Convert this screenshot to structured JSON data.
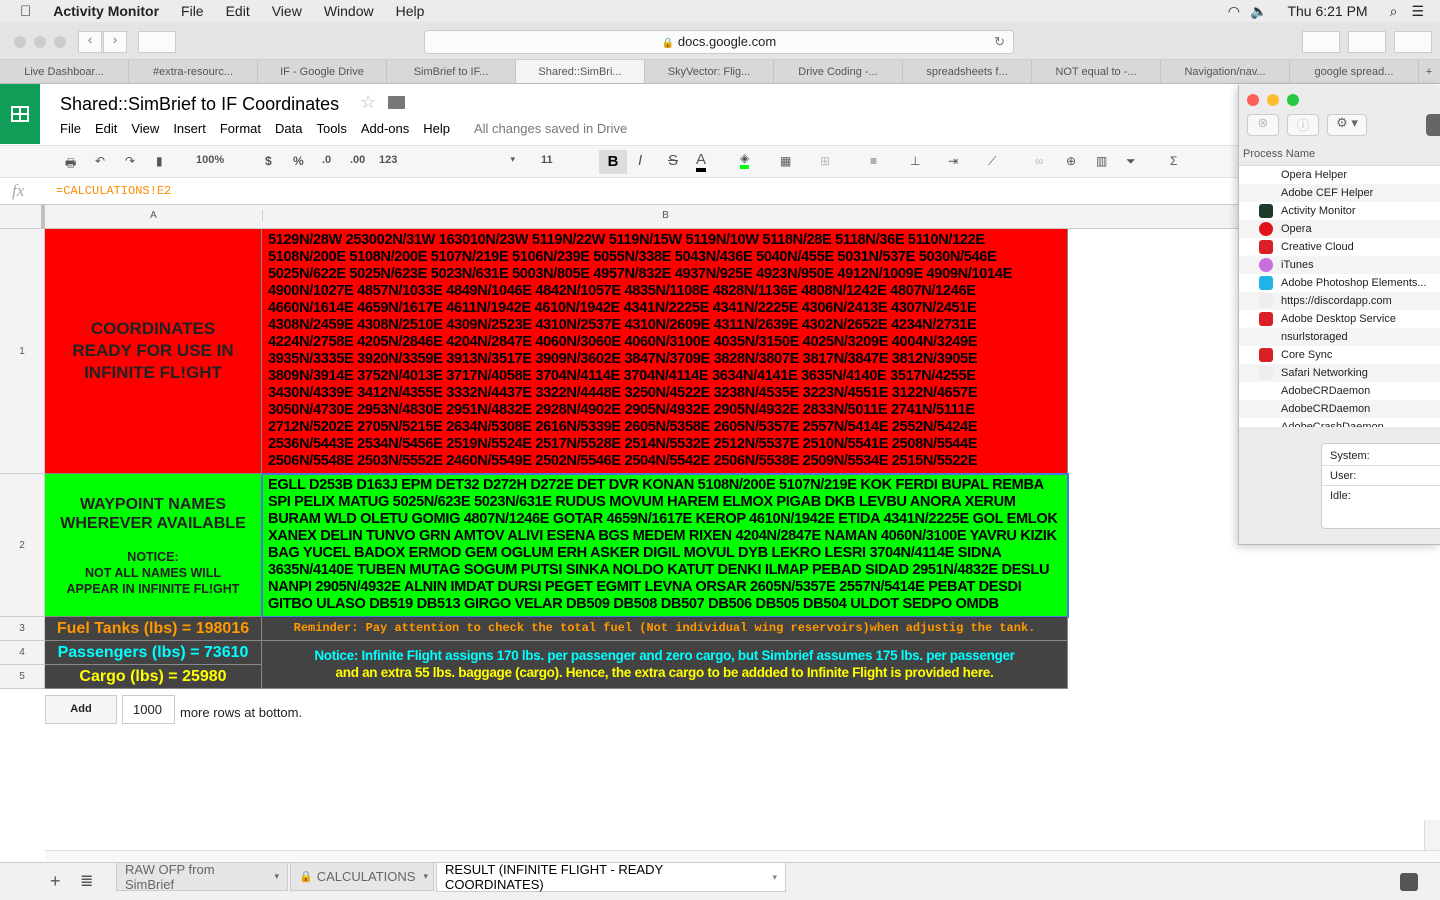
{
  "menubar": {
    "app": "Activity Monitor",
    "items": [
      "File",
      "Edit",
      "View",
      "Window",
      "Help"
    ],
    "clock": "Thu 6:21 PM"
  },
  "browser": {
    "url": "docs.google.com",
    "tabs": [
      "Live Dashboar...",
      "#extra-resourc...",
      "IF - Google Drive",
      "SimBrief to IF...",
      "Shared::SimBri...",
      "SkyVector: Flig...",
      "Drive Coding -...",
      "spreadsheets f...",
      "NOT equal to -...",
      "Navigation/nav...",
      "google spread..."
    ],
    "active_tab": 4
  },
  "doc": {
    "title": "Shared::SimBrief to IF Coordinates",
    "menus": [
      "File",
      "Edit",
      "View",
      "Insert",
      "Format",
      "Data",
      "Tools",
      "Add-ons",
      "Help"
    ],
    "save_status": "All changes saved in Drive"
  },
  "toolbar": {
    "zoom": "100%",
    "currency": "$",
    "percent": "%",
    "dec_less": ".0",
    "dec_more": ".00",
    "format": "123",
    "font_size": "11",
    "bold": "B",
    "italic": "I",
    "strike": "S",
    "text_color": "A"
  },
  "formula": {
    "fx": "fx",
    "value": "=CALCULATIONS!E2"
  },
  "columns": [
    "A",
    "B"
  ],
  "rows": [
    "1",
    "2",
    "3",
    "4",
    "5"
  ],
  "colors": {
    "red": "#ff0000",
    "green": "#00ff00",
    "dark": "#434343",
    "orange": "#ff9900",
    "cyan": "#00ffff",
    "yellow": "#ffff00"
  },
  "cells": {
    "a1": [
      "COORDINATES",
      "READY FOR USE IN",
      "INFINITE FL!GHT"
    ],
    "b1": [
      "5129N/28W 253002N/31W 163010N/23W 5119N/22W 5119N/15W 5119N/10W 5118N/28E 5118N/36E 5110N/122E",
      "5108N/200E 5108N/200E 5107N/219E 5106N/239E 5055N/338E 5043N/436E 5040N/455E 5031N/537E 5030N/546E",
      "5025N/622E 5025N/623E 5023N/631E 5003N/805E 4957N/832E 4937N/925E 4923N/950E 4912N/1009E 4909N/1014E",
      "4900N/1027E 4857N/1033E 4849N/1046E 4842N/1057E 4835N/1108E 4828N/1136E 4808N/1242E 4807N/1246E",
      "4660N/1614E 4659N/1617E 4611N/1942E 4610N/1942E 4341N/2225E 4341N/2225E 4306N/2413E 4307N/2451E",
      "4308N/2459E 4308N/2510E 4309N/2523E 4310N/2537E 4310N/2609E 4311N/2639E 4302N/2652E 4234N/2731E",
      "4224N/2758E 4205N/2846E 4204N/2847E 4060N/3060E 4060N/3100E 4035N/3150E 4025N/3209E 4004N/3249E",
      "3935N/3335E 3920N/3359E 3913N/3517E 3909N/3602E 3847N/3709E 3828N/3807E 3817N/3847E 3812N/3905E",
      "3809N/3914E 3752N/4013E 3717N/4058E 3704N/4114E 3704N/4114E 3634N/4141E 3635N/4140E 3517N/4255E",
      "3430N/4339E 3412N/4355E 3332N/4437E 3322N/4448E 3250N/4522E 3238N/4535E 3223N/4551E 3122N/4657E",
      "3050N/4730E 2953N/4830E 2951N/4832E 2928N/4902E 2905N/4932E 2905N/4932E 2833N/5011E 2741N/5111E",
      "2712N/5202E 2705N/5215E 2634N/5308E 2616N/5339E 2605N/5358E 2605N/5357E 2557N/5414E 2552N/5424E",
      "2536N/5443E 2534N/5456E 2519N/5524E 2517N/5528E 2514N/5532E 2512N/5537E 2510N/5541E 2508N/5544E",
      "2506N/5548E 2503N/5552E 2460N/5549E 2502N/5546E 2504N/5542E 2506N/5538E 2509N/5534E 2515N/5522E"
    ],
    "a2_title": [
      "WAYPOINT NAMES",
      "WHEREVER AVAILABLE"
    ],
    "a2_notice": [
      "NOTICE:",
      "NOT ALL NAMES WILL",
      "APPEAR IN INFINITE FL!GHT"
    ],
    "b2": [
      "EGLL D253B D163J EPM DET32 D272H D272E DET DVR KONAN 5108N/200E 5107N/219E KOK FERDI BUPAL REMBA",
      "SPI PELIX MATUG 5025N/623E 5023N/631E RUDUS MOVUM HAREM ELMOX PIGAB DKB LEVBU ANORA XERUM",
      "BURAM WLD OLETU GOMIG 4807N/1246E GOTAR 4659N/1617E KEROP 4610N/1942E ETIDA 4341N/2225E GOL EMLOK",
      "XANEX DELIN TUNVO GRN AMTOV ALIVI ESENA BGS MEDEM RIXEN 4204N/2847E NAMAN 4060N/3100E YAVRU KIZIK",
      "BAG YUCEL BADOX ERMOD GEM OGLUM ERH ASKER DIGIL MOVUL DYB LEKRO LESRI 3704N/4114E SIDNA",
      "3635N/4140E TUBEN MUTAG SOGUM PUTSI SINKA NOLDO KATUT DENKI ILMAP PEBAD SIDAD 2951N/4832E DESLU",
      "NANPI 2905N/4932E ALNIN IMDAT DURSI PEGET EGMIT LEVNA ORSAR 2605N/5357E 2557N/5414E PEBAT DESDI",
      "GITBO ULASO DB519 DB513 GIRGO VELAR DB509 DB508 DB507 DB506 DB505 DB504 ULDOT SEDPO OMDB"
    ],
    "a3": "Fuel Tanks (lbs) = 198016",
    "a4": "Passengers (lbs) = 73610",
    "a5": "Cargo (lbs) = 25980",
    "b3": "Reminder: Pay attention to check the total fuel (Not individual wing reservoirs)when adjustig the tank.",
    "b4": [
      "Notice: Infinite Flight assigns 170 lbs. per passenger and zero cargo, but Simbrief assumes 175 lbs. per passenger",
      "and an extra 55 lbs. baggage (cargo). Hence, the extra cargo to be addded to Infinite Flight is provided here."
    ]
  },
  "add_rows": {
    "button": "Add",
    "count": "1000",
    "suffix": "more rows at bottom."
  },
  "sheet_tabs": [
    "RAW OFP from SimBrief",
    "CALCULATIONS",
    "RESULT (INFINITE FLIGHT - READY COORDINATES)"
  ],
  "activity_monitor": {
    "column": "Process Name",
    "processes": [
      {
        "name": "Opera Helper",
        "icon": "none"
      },
      {
        "name": "Adobe CEF Helper",
        "icon": "none"
      },
      {
        "name": "Activity Monitor",
        "icon": "activity-monitor-icon"
      },
      {
        "name": "Opera",
        "icon": "opera-icon"
      },
      {
        "name": "Creative Cloud",
        "icon": "creative-cloud-icon"
      },
      {
        "name": "iTunes",
        "icon": "itunes-icon"
      },
      {
        "name": "Adobe Photoshop Elements...",
        "icon": "photoshop-elements-icon"
      },
      {
        "name": "https://discordapp.com",
        "icon": "generic-app-icon"
      },
      {
        "name": "Adobe Desktop Service",
        "icon": "creative-cloud-icon"
      },
      {
        "name": "nsurlstoraged",
        "icon": "none"
      },
      {
        "name": "Core Sync",
        "icon": "creative-cloud-icon"
      },
      {
        "name": "Safari Networking",
        "icon": "generic-app-icon"
      },
      {
        "name": "AdobeCRDaemon",
        "icon": "none"
      },
      {
        "name": "AdobeCRDaemon",
        "icon": "none"
      },
      {
        "name": "AdobeCrashDaemon",
        "icon": "none"
      }
    ],
    "stats": [
      "System:",
      "User:",
      "Idle:"
    ]
  }
}
